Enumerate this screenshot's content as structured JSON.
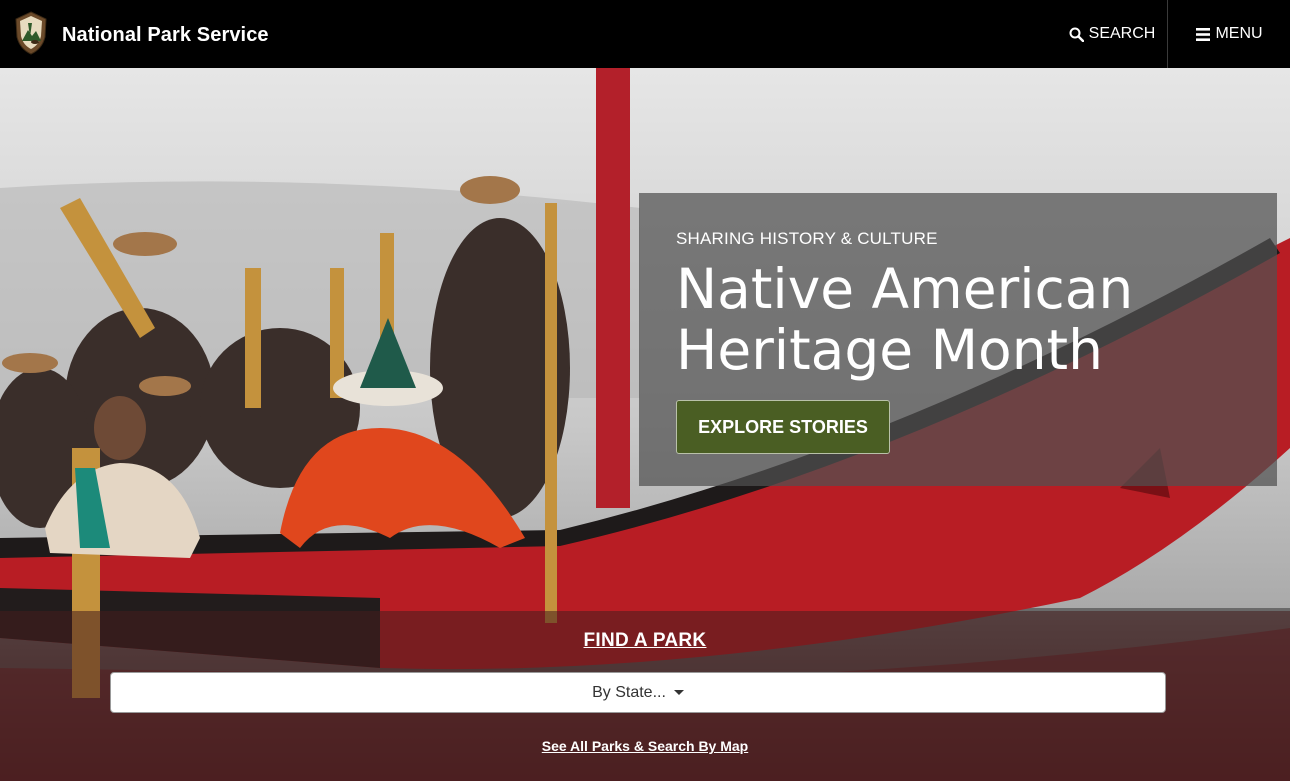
{
  "header": {
    "site_name": "National Park Service",
    "search_label": "SEARCH",
    "menu_label": "MENU",
    "logo_icon": "arrowhead-icon",
    "search_icon": "search-icon",
    "menu_icon": "hamburger-icon"
  },
  "hero": {
    "kicker": "SHARING HISTORY & CULTURE",
    "headline": "Native American Heritage Month",
    "cta_label": "EXPLORE STORIES",
    "cta_color": "#4a5e23"
  },
  "find_park": {
    "title": "FIND A PARK",
    "select_value": "By State...",
    "map_link": "See All Parks & Search By Map"
  }
}
